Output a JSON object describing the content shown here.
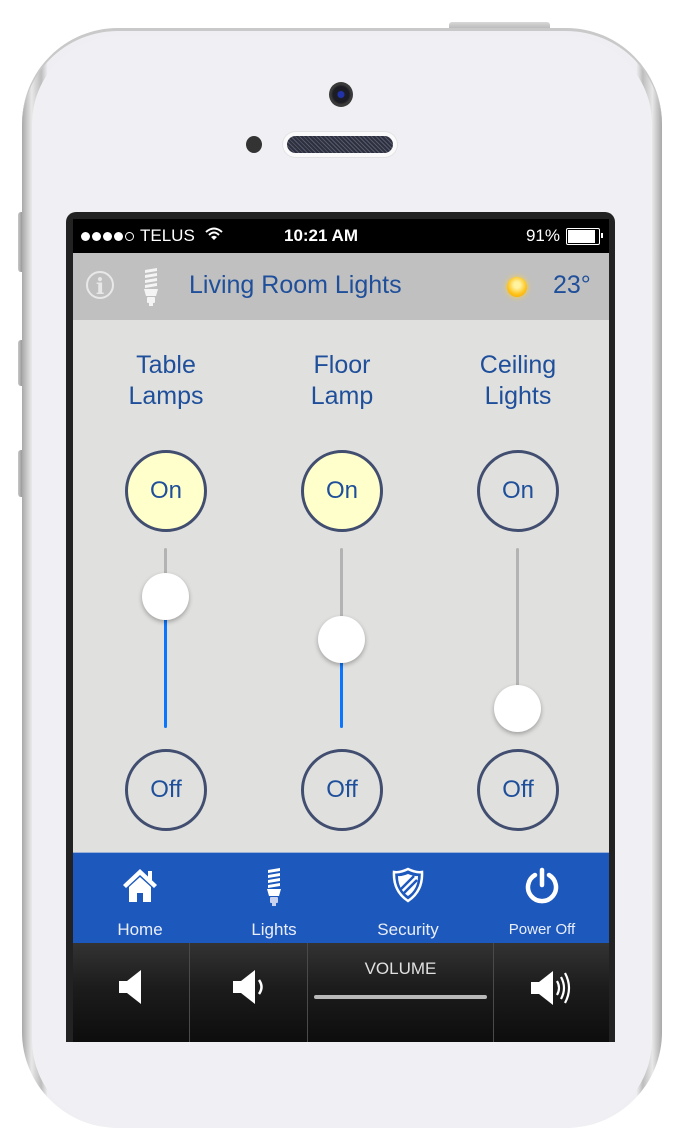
{
  "status_bar": {
    "carrier": "TELUS",
    "signal_bars_filled": 4,
    "signal_bars_total": 5,
    "time": "10:21 AM",
    "battery": "91%",
    "battery_level": 0.91
  },
  "header": {
    "title": "Living Room Lights",
    "temperature": "23°",
    "icons": [
      "info-icon",
      "lightbulb-icon",
      "sun-icon"
    ]
  },
  "devices": [
    {
      "name": "Table Lamps",
      "on_label": "On",
      "off_label": "Off",
      "is_on": true,
      "dimmer_level_percent": 80
    },
    {
      "name": "Floor Lamp",
      "on_label": "On",
      "off_label": "Off",
      "is_on": true,
      "dimmer_level_percent": 49
    },
    {
      "name": "Ceiling Lights",
      "on_label": "On",
      "off_label": "Off",
      "is_on": false,
      "dimmer_level_percent": 0
    }
  ],
  "tabbar": {
    "items": [
      {
        "label": "Home",
        "icon": "home-icon"
      },
      {
        "label": "Lights",
        "icon": "lightbulb-icon"
      },
      {
        "label": "Security",
        "icon": "shield-icon"
      },
      {
        "label": "Power Off",
        "icon": "power-icon"
      }
    ]
  },
  "volume_bar": {
    "label": "VOLUME",
    "buttons": [
      "mute-icon",
      "volume-down-icon",
      "volume-up-icon"
    ]
  },
  "colors": {
    "accent_text": "#1f4f9a",
    "tabbar_bg": "#1d58bd",
    "on_fill": "#ffffcc",
    "slider_fill": "#0a76ff",
    "header_bg": "#c0c0c0",
    "content_bg": "#e0e1df"
  }
}
